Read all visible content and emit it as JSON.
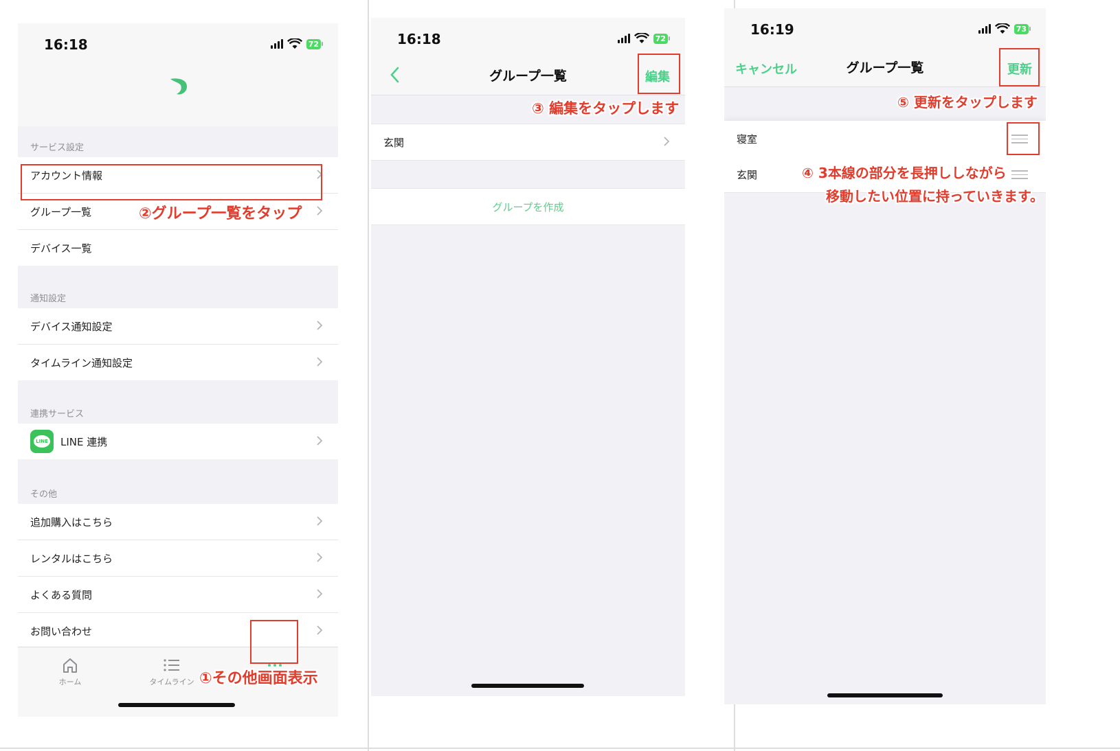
{
  "screen1": {
    "time": "16:18",
    "battery": "72",
    "sections": {
      "service": {
        "title": "サービス設定",
        "items": [
          "アカウント情報",
          "グループ一覧",
          "デバイス一覧"
        ]
      },
      "notify": {
        "title": "通知設定",
        "items": [
          "デバイス通知設定",
          "タイムライン通知設定"
        ]
      },
      "linked": {
        "title": "連携サービス",
        "line_label": "LINE 連携",
        "line_logo": "LINE"
      },
      "other": {
        "title": "その他",
        "items": [
          "追加購入はこちら",
          "レンタルはこちら",
          "よくある質問",
          "お問い合わせ"
        ]
      }
    },
    "tabs": [
      "ホーム",
      "タイムライン",
      "その他"
    ],
    "annotations": {
      "step1": "①その他画面表示",
      "step2": "②グループ一覧をタップ"
    }
  },
  "screen2": {
    "time": "16:18",
    "battery": "72",
    "title": "グループ一覧",
    "edit_label": "編集",
    "items": [
      "玄関"
    ],
    "create_label": "グループを作成",
    "annotations": {
      "step3": "③ 編集をタップします"
    }
  },
  "screen3": {
    "time": "16:19",
    "battery": "73",
    "title": "グループ一覧",
    "cancel_label": "キャンセル",
    "update_label": "更新",
    "items": [
      "寝室",
      "玄関"
    ],
    "annotations": {
      "step5": "⑤ 更新をタップします",
      "step4_line1": "④ 3本線の部分を長押ししながら",
      "step4_line2": "移動したい位置に持っていきます。"
    }
  },
  "colors": {
    "accent": "#4cd08a",
    "annotation": "#e23c2c",
    "background": "#f2f2f6",
    "line_green": "#3cc25a"
  }
}
